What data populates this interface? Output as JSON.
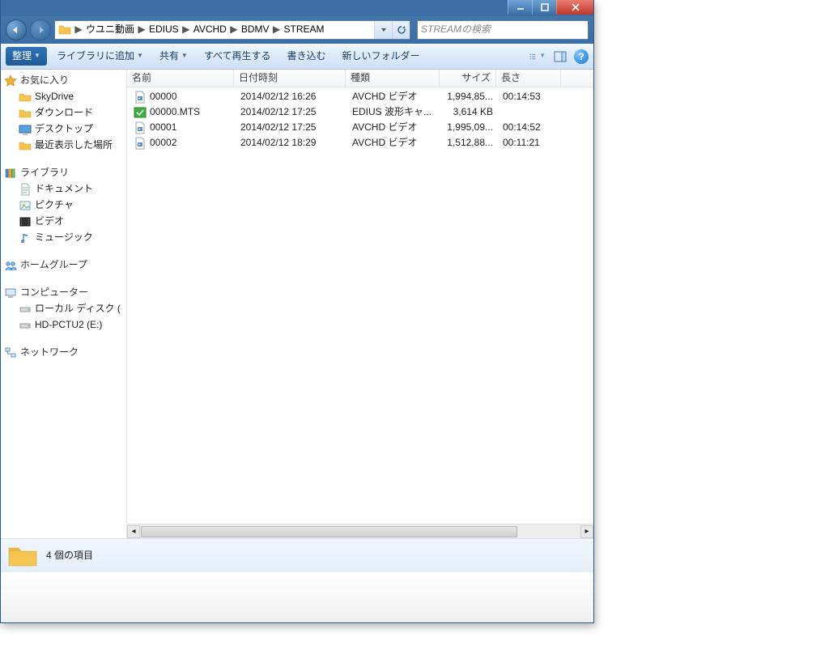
{
  "address": {
    "crumbs": [
      "ウユニ動画",
      "EDIUS",
      "AVCHD",
      "BDMV",
      "STREAM"
    ]
  },
  "search": {
    "placeholder": "STREAMの検索"
  },
  "toolbar": {
    "organize": "整理",
    "include": "ライブラリに追加",
    "share": "共有",
    "play_all": "すべて再生する",
    "burn": "書き込む",
    "new_folder": "新しいフォルダー"
  },
  "navpane": {
    "favorites": {
      "title": "お気に入り",
      "items": [
        "SkyDrive",
        "ダウンロード",
        "デスクトップ",
        "最近表示した場所"
      ]
    },
    "libraries": {
      "title": "ライブラリ",
      "items": [
        "ドキュメント",
        "ピクチャ",
        "ビデオ",
        "ミュージック"
      ]
    },
    "homegroup": {
      "title": "ホームグループ"
    },
    "computer": {
      "title": "コンピューター",
      "items": [
        "ローカル ディスク (",
        "HD-PCTU2 (E:)"
      ]
    },
    "network": {
      "title": "ネットワーク"
    }
  },
  "columns": {
    "name": "名前",
    "date": "日付時刻",
    "type": "種類",
    "size": "サイズ",
    "length": "長さ"
  },
  "files": [
    {
      "name": "00000",
      "date": "2014/02/12 16:26",
      "type": "AVCHD ビデオ",
      "size": "1,994,85...",
      "length": "00:14:53",
      "kind": "video"
    },
    {
      "name": "00000.MTS",
      "date": "2014/02/12 17:25",
      "type": "EDIUS 波形キャ...",
      "size": "3,614 KB",
      "length": "",
      "kind": "edius"
    },
    {
      "name": "00001",
      "date": "2014/02/12 17:25",
      "type": "AVCHD ビデオ",
      "size": "1,995,09...",
      "length": "00:14:52",
      "kind": "video"
    },
    {
      "name": "00002",
      "date": "2014/02/12 18:29",
      "type": "AVCHD ビデオ",
      "size": "1,512,88...",
      "length": "00:11:21",
      "kind": "video"
    }
  ],
  "status": {
    "count": "4 個の項目"
  }
}
